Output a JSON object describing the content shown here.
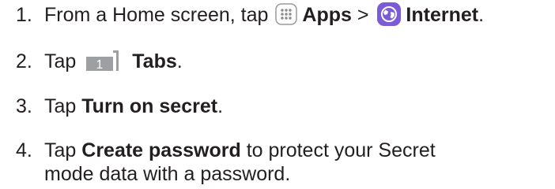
{
  "steps": [
    {
      "number": "1.",
      "pre": "From a Home screen, tap",
      "apps_label": "Apps",
      "separator": ">",
      "internet_label": "Internet",
      "post": ".",
      "icons": [
        "apps-grid-icon",
        "internet-globe-icon"
      ]
    },
    {
      "number": "2.",
      "pre": "Tap",
      "tab_count": "1",
      "bold": "Tabs",
      "post": ".",
      "icons": [
        "tabs-icon"
      ]
    },
    {
      "number": "3.",
      "pre": "Tap",
      "bold": "Turn on secret",
      "post": "."
    },
    {
      "number": "4.",
      "pre": "Tap",
      "bold": "Create password",
      "post_line1": "to protect your Secret",
      "line2": "mode data with a password."
    }
  ],
  "colors": {
    "text": "#231f20",
    "internet_icon": "#7b5cd6",
    "tabs_icon": "#9e9fa2",
    "apps_icon_dots": "#8a8a8a"
  }
}
